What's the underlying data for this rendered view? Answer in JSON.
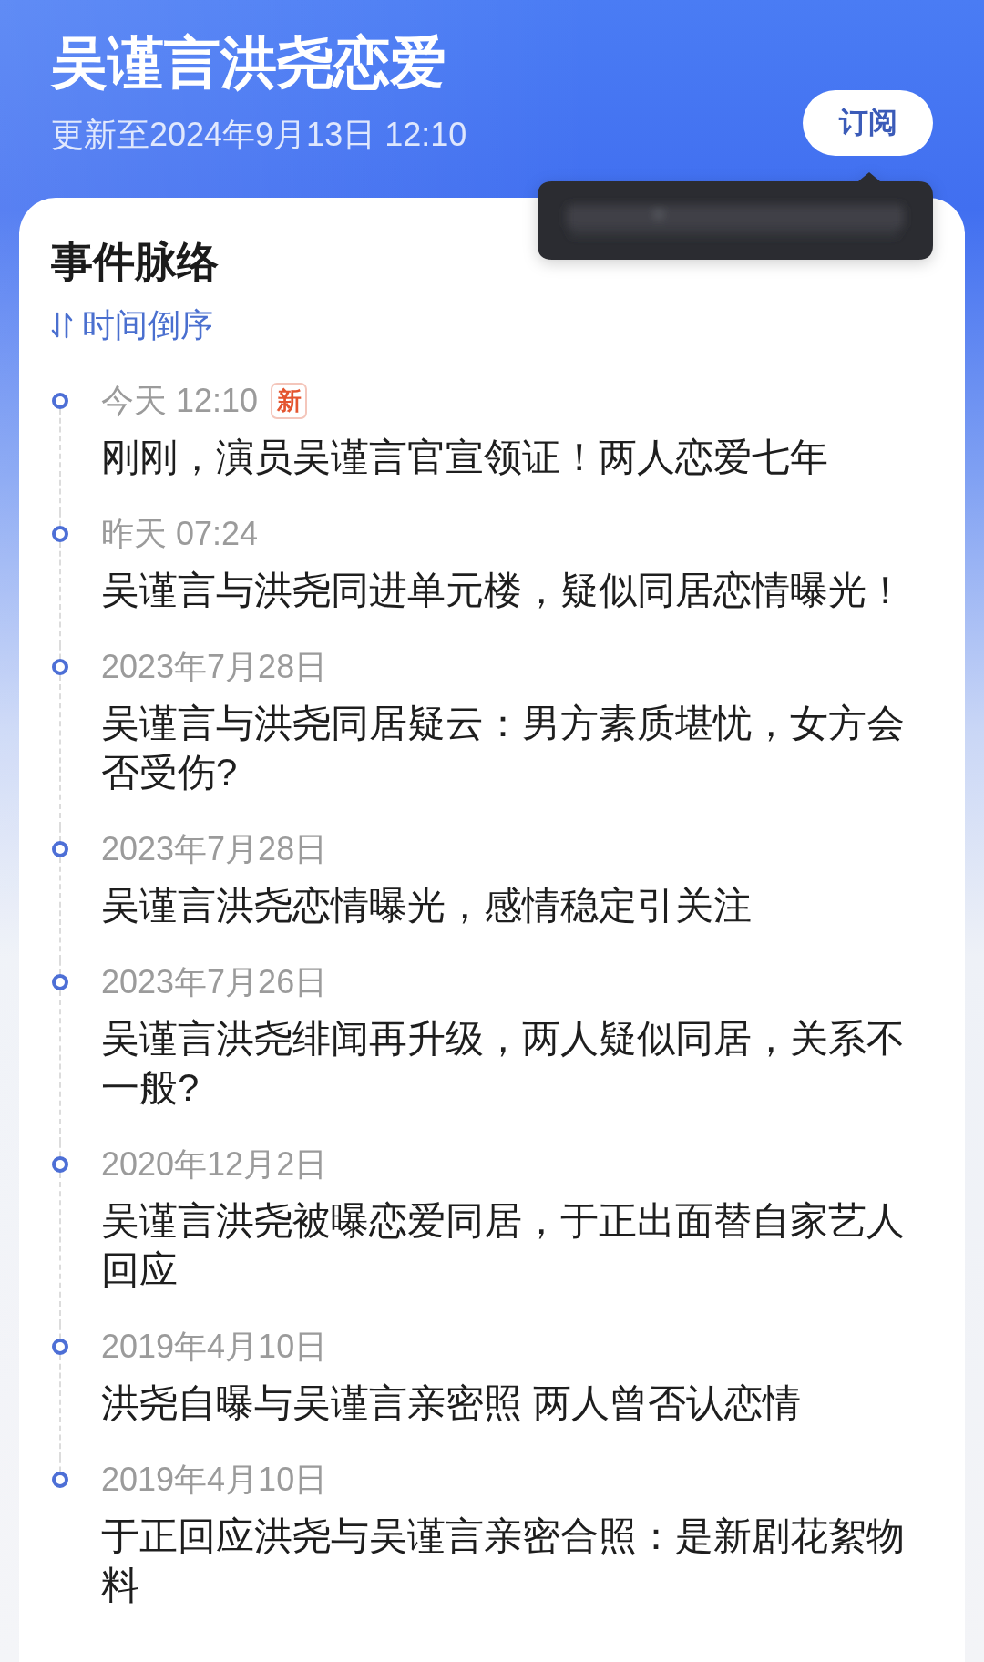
{
  "header": {
    "title": "吴谨言洪尧恋爱",
    "updated": "更新至2024年9月13日 12:10",
    "subscribe_button": "订阅"
  },
  "subscribe_tooltip": {
    "visible": true
  },
  "timeline": {
    "title": "事件脉络",
    "sort_label": "时间倒序",
    "events": [
      {
        "date": "今天 12:10",
        "badge": "新",
        "headline": "刚刚，演员吴谨言官宣领证！两人恋爱七年"
      },
      {
        "date": "昨天 07:24",
        "headline": "吴谨言与洪尧同进单元楼，疑似同居恋情曝光！"
      },
      {
        "date": "2023年7月28日",
        "headline": "吴谨言与洪尧同居疑云：男方素质堪忧，女方会否受伤?"
      },
      {
        "date": "2023年7月28日",
        "headline": "吴谨言洪尧恋情曝光，感情稳定引关注"
      },
      {
        "date": "2023年7月26日",
        "headline": "吴谨言洪尧绯闻再升级，两人疑似同居，关系不一般?"
      },
      {
        "date": "2020年12月2日",
        "headline": "吴谨言洪尧被曝恋爱同居，于正出面替自家艺人回应"
      },
      {
        "date": "2019年4月10日",
        "headline": "洪尧自曝与吴谨言亲密照 两人曾否认恋情"
      },
      {
        "date": "2019年4月10日",
        "headline": "于正回应洪尧与吴谨言亲密合照：是新剧花絮物料"
      }
    ]
  }
}
